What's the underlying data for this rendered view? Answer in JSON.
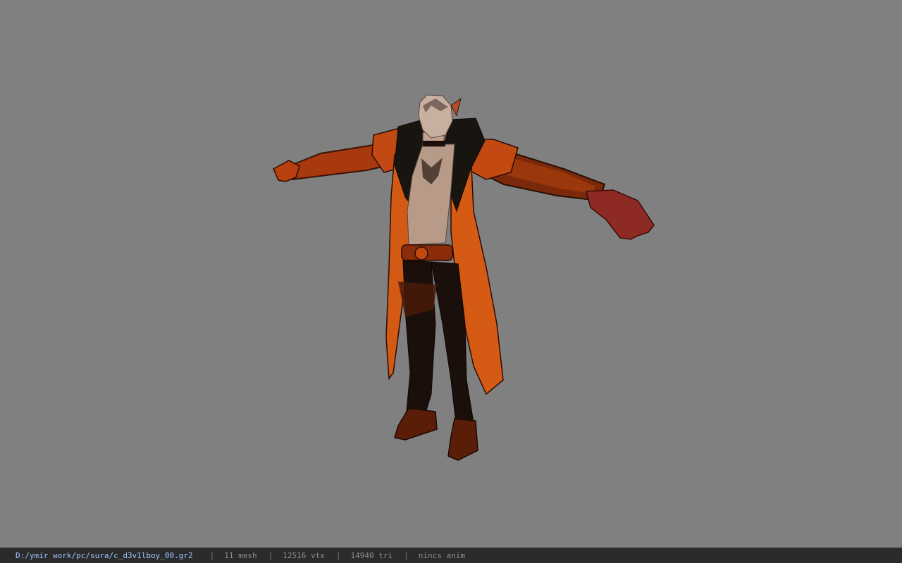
{
  "model": {
    "name": "sura character model in T-pose"
  },
  "status": {
    "file_path": "D:/ymir work/pc/sura/c_d3v1lboy_00.gr2",
    "separator": "|",
    "mesh": "11 mesh",
    "vertices": "12516 vtx",
    "triangles": "14940 tri",
    "animation": "nincs anim"
  },
  "colors": {
    "background": "#808080",
    "statusbar_bg": "#2b2b2b",
    "path_text": "#9fc6ff",
    "stat_text": "#8e8e8e"
  }
}
